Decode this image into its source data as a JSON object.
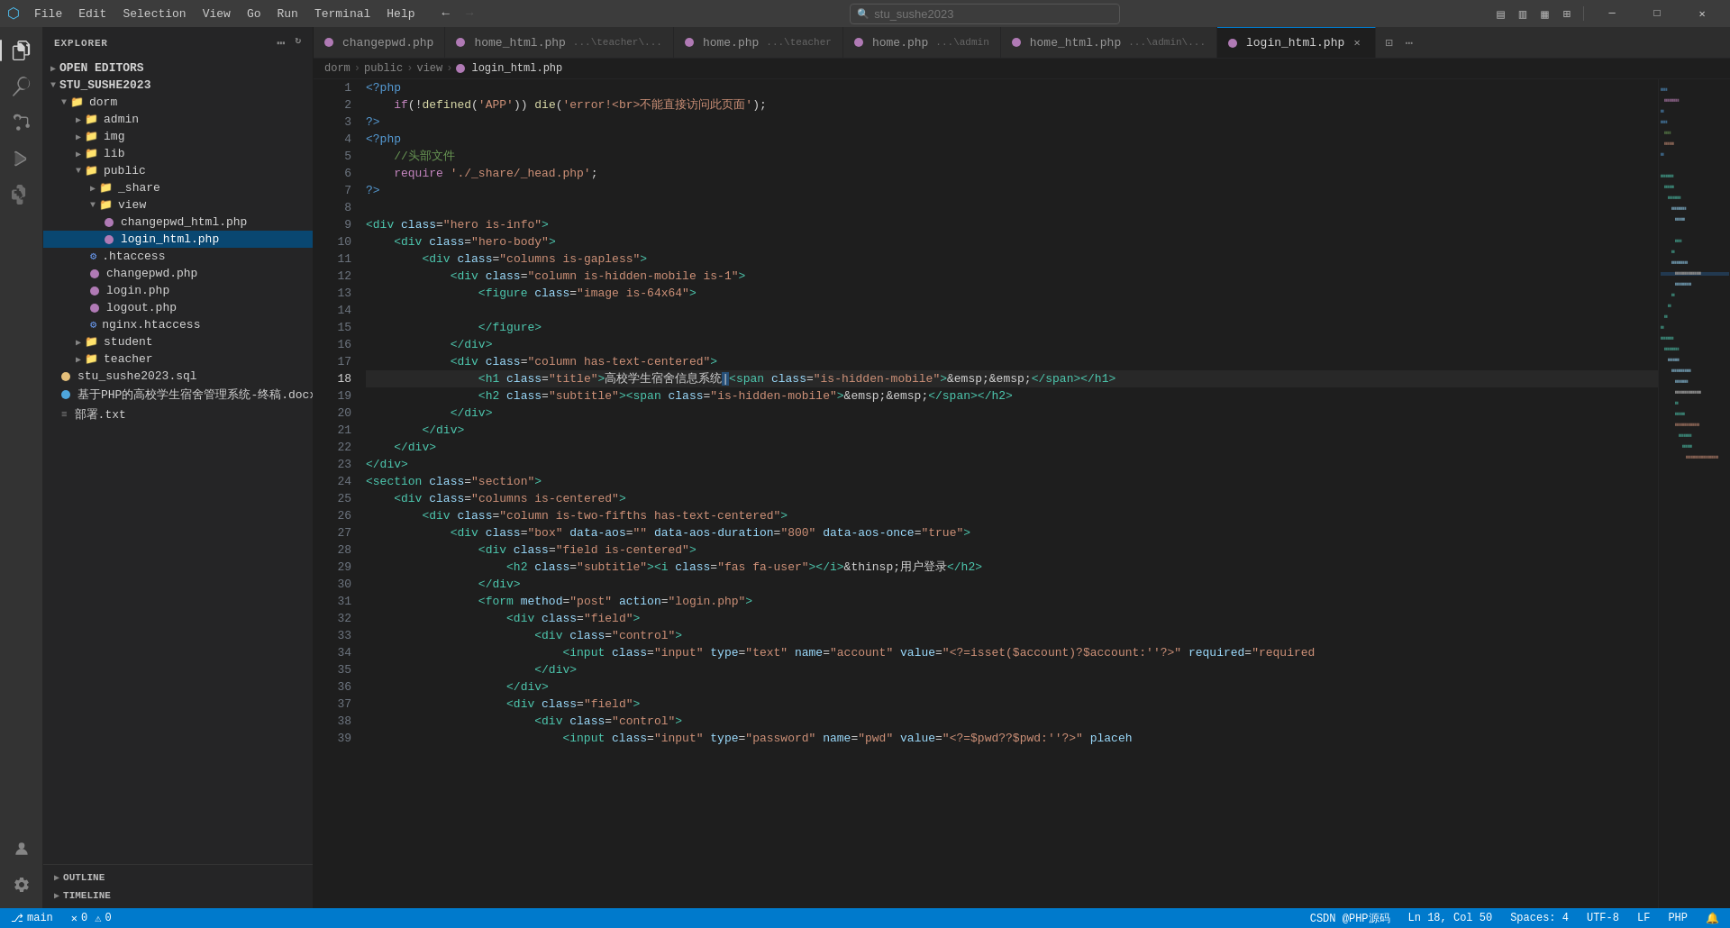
{
  "titlebar": {
    "icon": "⬛",
    "menus": [
      "File",
      "Edit",
      "Selection",
      "View",
      "Go",
      "Run",
      "Terminal",
      "Help"
    ],
    "search_placeholder": "stu_sushe2023",
    "btn_minimize": "─",
    "btn_maximize": "□",
    "btn_close": "✕",
    "nav_back": "←",
    "nav_fwd": "→",
    "btn_sidebar": "▤",
    "btn_layout1": "▥",
    "btn_layout2": "▦",
    "btn_layout3": "▧"
  },
  "activity": {
    "items": [
      {
        "name": "explorer",
        "icon": "⎗",
        "active": true
      },
      {
        "name": "search",
        "icon": "🔍",
        "active": false
      },
      {
        "name": "source-control",
        "icon": "⎇",
        "active": false
      },
      {
        "name": "run",
        "icon": "▷",
        "active": false
      },
      {
        "name": "extensions",
        "icon": "⊞",
        "active": false
      }
    ],
    "bottom": [
      {
        "name": "remote",
        "icon": "⊕"
      },
      {
        "name": "account",
        "icon": "👤"
      },
      {
        "name": "settings",
        "icon": "⚙"
      }
    ]
  },
  "sidebar": {
    "title": "EXPLORER",
    "actions": [
      "⋯",
      "↻"
    ],
    "sections": {
      "open_editors": "OPEN EDITORS",
      "project": "STU_SUSHE2023"
    },
    "tree": [
      {
        "indent": 0,
        "type": "folder",
        "label": "dorm",
        "open": true
      },
      {
        "indent": 1,
        "type": "folder",
        "label": "admin",
        "open": false
      },
      {
        "indent": 1,
        "type": "folder",
        "label": "img",
        "open": false
      },
      {
        "indent": 1,
        "type": "folder",
        "label": "lib",
        "open": false
      },
      {
        "indent": 1,
        "type": "folder",
        "label": "public",
        "open": true
      },
      {
        "indent": 2,
        "type": "folder",
        "label": "_share",
        "open": false
      },
      {
        "indent": 2,
        "type": "folder",
        "label": "view",
        "open": true
      },
      {
        "indent": 3,
        "type": "php",
        "label": "changepwd_html.php"
      },
      {
        "indent": 3,
        "type": "php",
        "label": "login_html.php",
        "active": true
      },
      {
        "indent": 2,
        "type": "htaccess",
        "label": ".htaccess"
      },
      {
        "indent": 2,
        "type": "php",
        "label": "changepwd.php"
      },
      {
        "indent": 2,
        "type": "php",
        "label": "login.php"
      },
      {
        "indent": 2,
        "type": "php",
        "label": "logout.php"
      },
      {
        "indent": 2,
        "type": "htaccess",
        "label": "nginx.htaccess"
      },
      {
        "indent": 1,
        "type": "folder",
        "label": "student",
        "open": false
      },
      {
        "indent": 1,
        "type": "folder",
        "label": "teacher",
        "open": false
      },
      {
        "indent": 0,
        "type": "sql",
        "label": "stu_sushe2023.sql"
      },
      {
        "indent": 0,
        "type": "docx",
        "label": "基于PHP的高校学生宿舍管理系统-终稿.docx"
      },
      {
        "indent": 0,
        "type": "txt",
        "label": "部署.txt"
      }
    ],
    "bottom_items": [
      "OUTLINE",
      "TIMELINE"
    ]
  },
  "tabs": [
    {
      "label": "changepwd.php",
      "icon": "php",
      "active": false,
      "path": ""
    },
    {
      "label": "home_html.php",
      "icon": "php",
      "active": false,
      "path": "...\\teacher\\...",
      "modified": false
    },
    {
      "label": "home.php",
      "icon": "php",
      "active": false,
      "path": "...\\teacher"
    },
    {
      "label": "home.php",
      "icon": "php",
      "active": false,
      "path": "...\\admin"
    },
    {
      "label": "home_html.php",
      "icon": "php",
      "active": false,
      "path": "...\\admin\\..."
    },
    {
      "label": "login_html.php",
      "icon": "php",
      "active": true,
      "path": "",
      "closeable": true
    }
  ],
  "breadcrumb": {
    "parts": [
      "dorm",
      "public",
      "view",
      "login_html.php"
    ]
  },
  "code": {
    "lines": [
      {
        "num": 1,
        "content": "<?php"
      },
      {
        "num": 2,
        "content": "    if(!defined('APP')) die('error!<br>不能直接访问此页面');"
      },
      {
        "num": 3,
        "content": "?>"
      },
      {
        "num": 4,
        "content": "<?php"
      },
      {
        "num": 5,
        "content": "    //头部文件"
      },
      {
        "num": 6,
        "content": "    require './_share/_head.php';"
      },
      {
        "num": 7,
        "content": "?>"
      },
      {
        "num": 8,
        "content": ""
      },
      {
        "num": 9,
        "content": "<div class=\"hero is-info\">"
      },
      {
        "num": 10,
        "content": "    <div class=\"hero-body\">"
      },
      {
        "num": 11,
        "content": "        <div class=\"columns is-gapless\">"
      },
      {
        "num": 12,
        "content": "            <div class=\"column is-hidden-mobile is-1\">"
      },
      {
        "num": 13,
        "content": "                <figure class=\"image is-64x64\">"
      },
      {
        "num": 14,
        "content": ""
      },
      {
        "num": 15,
        "content": "                </figure>"
      },
      {
        "num": 16,
        "content": "            </div>"
      },
      {
        "num": 17,
        "content": "            <div class=\"column has-text-centered\">"
      },
      {
        "num": 18,
        "content": "                <h1 class=\"title\">高校学生宿舍信息系统<span class=\"is-hidden-mobile\">&emsp;&emsp;</span></h1>"
      },
      {
        "num": 19,
        "content": "                <h2 class=\"subtitle\"><span class=\"is-hidden-mobile\">&emsp;&emsp;</span></h2>"
      },
      {
        "num": 20,
        "content": "            </div>"
      },
      {
        "num": 21,
        "content": "        </div>"
      },
      {
        "num": 22,
        "content": "    </div>"
      },
      {
        "num": 23,
        "content": "</div>"
      },
      {
        "num": 24,
        "content": "<section class=\"section\">"
      },
      {
        "num": 25,
        "content": "    <div class=\"columns is-centered\">"
      },
      {
        "num": 26,
        "content": "        <div class=\"column is-two-fifths has-text-centered\">"
      },
      {
        "num": 27,
        "content": "            <div class=\"box\" data-aos=\"\" data-aos-duration=\"800\" data-aos-once=\"true\">"
      },
      {
        "num": 28,
        "content": "                <div class=\"field is-centered\">"
      },
      {
        "num": 29,
        "content": "                    <h2 class=\"subtitle\"><i class=\"fas fa-user\"></i>&thinsp;用户登录</h2>"
      },
      {
        "num": 30,
        "content": "                </div>"
      },
      {
        "num": 31,
        "content": "                <form method=\"post\" action=\"login.php\">"
      },
      {
        "num": 32,
        "content": "                    <div class=\"field\">"
      },
      {
        "num": 33,
        "content": "                        <div class=\"control\">"
      },
      {
        "num": 34,
        "content": "                            <input class=\"input\" type=\"text\" name=\"account\" value=\"<?=isset($account)?$account:''?>\" required=\"required"
      },
      {
        "num": 35,
        "content": "                        </div>"
      },
      {
        "num": 36,
        "content": "                    </div>"
      },
      {
        "num": 37,
        "content": "                    <div class=\"field\">"
      },
      {
        "num": 38,
        "content": "                        <div class=\"control\">"
      },
      {
        "num": 39,
        "content": "                            <input class=\"input\" type=\"password\" name=\"pwd\" value=\"<?=$pwd??$pwd:''?>\" placeh"
      }
    ]
  },
  "statusbar": {
    "branch": "main",
    "errors": "0",
    "warnings": "0",
    "line_col": "Ln 18, Col 50",
    "spaces": "Spaces: 4",
    "encoding": "UTF-8",
    "eol": "LF",
    "language": "PHP",
    "feedback": "CSDN @PHP源码",
    "notifications": "🔔"
  }
}
